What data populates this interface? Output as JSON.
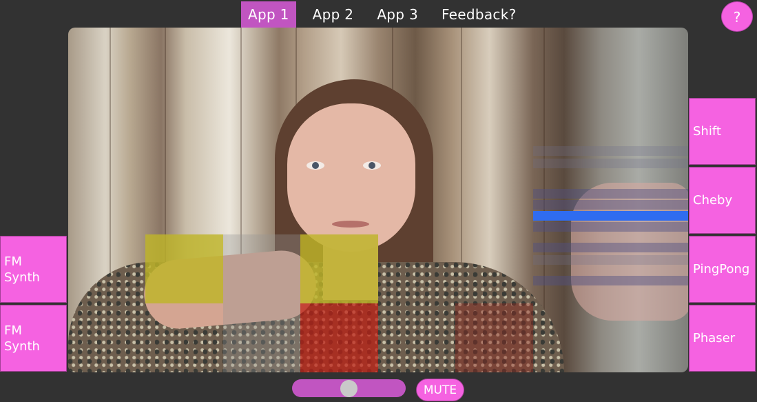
{
  "nav": {
    "tabs": [
      {
        "label": "App 1",
        "active": true
      },
      {
        "label": "App 2",
        "active": false
      },
      {
        "label": "App 3",
        "active": false
      },
      {
        "label": "Feedback?",
        "active": false
      }
    ],
    "help_label": "?"
  },
  "left_buttons": [
    {
      "label": "FM\nSynth"
    },
    {
      "label": "FM\nSynth"
    }
  ],
  "right_buttons": [
    {
      "label": "Shift"
    },
    {
      "label": "Cheby"
    },
    {
      "label": "PingPong"
    },
    {
      "label": "Phaser"
    }
  ],
  "controls": {
    "mute_label": "MUTE"
  },
  "colors": {
    "accent": "#f562e1",
    "accent_dark": "#c155c1",
    "background": "#323232",
    "active_band": "#2f6cf0"
  }
}
